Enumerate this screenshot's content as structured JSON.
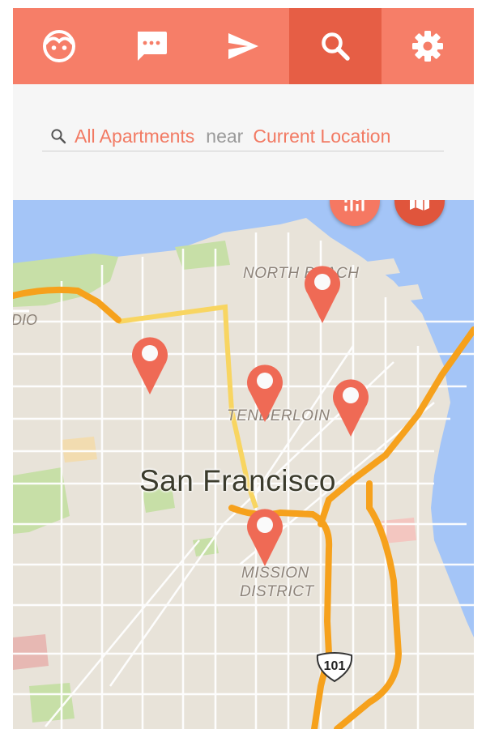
{
  "nav": {
    "items": [
      {
        "id": "profile",
        "icon": "face-icon",
        "active": false
      },
      {
        "id": "messages",
        "icon": "chat-bubble-icon",
        "active": false
      },
      {
        "id": "send",
        "icon": "send-icon",
        "active": false
      },
      {
        "id": "search",
        "icon": "search-icon",
        "active": true
      },
      {
        "id": "settings",
        "icon": "gear-icon",
        "active": false
      }
    ]
  },
  "search": {
    "icon": "search-icon",
    "category": "All Apartments",
    "connector": "near",
    "location": "Current Location"
  },
  "map": {
    "city_label": "San Francisco",
    "neighborhoods": [
      "NORTH BEACH",
      "TENDERLOIN",
      "MISSION",
      "DISTRICT"
    ],
    "edge_label": "DIO",
    "highway_shield": "101",
    "pins": [
      {
        "name": "north-beach"
      },
      {
        "name": "western-addition"
      },
      {
        "name": "tenderloin"
      },
      {
        "name": "soma"
      },
      {
        "name": "mission"
      }
    ]
  },
  "actions": {
    "filter": {
      "icon": "filter-sliders-icon"
    },
    "map_view": {
      "icon": "map-icon"
    }
  },
  "colors": {
    "primary": "#f67e68",
    "primary_dark": "#e65e45",
    "accent_text": "#f27a63",
    "pin": "#ef6a55",
    "water": "#a4c5f7",
    "land": "#e8e3d9",
    "park": "#c7dfa7",
    "highway": "#f6a11c"
  }
}
